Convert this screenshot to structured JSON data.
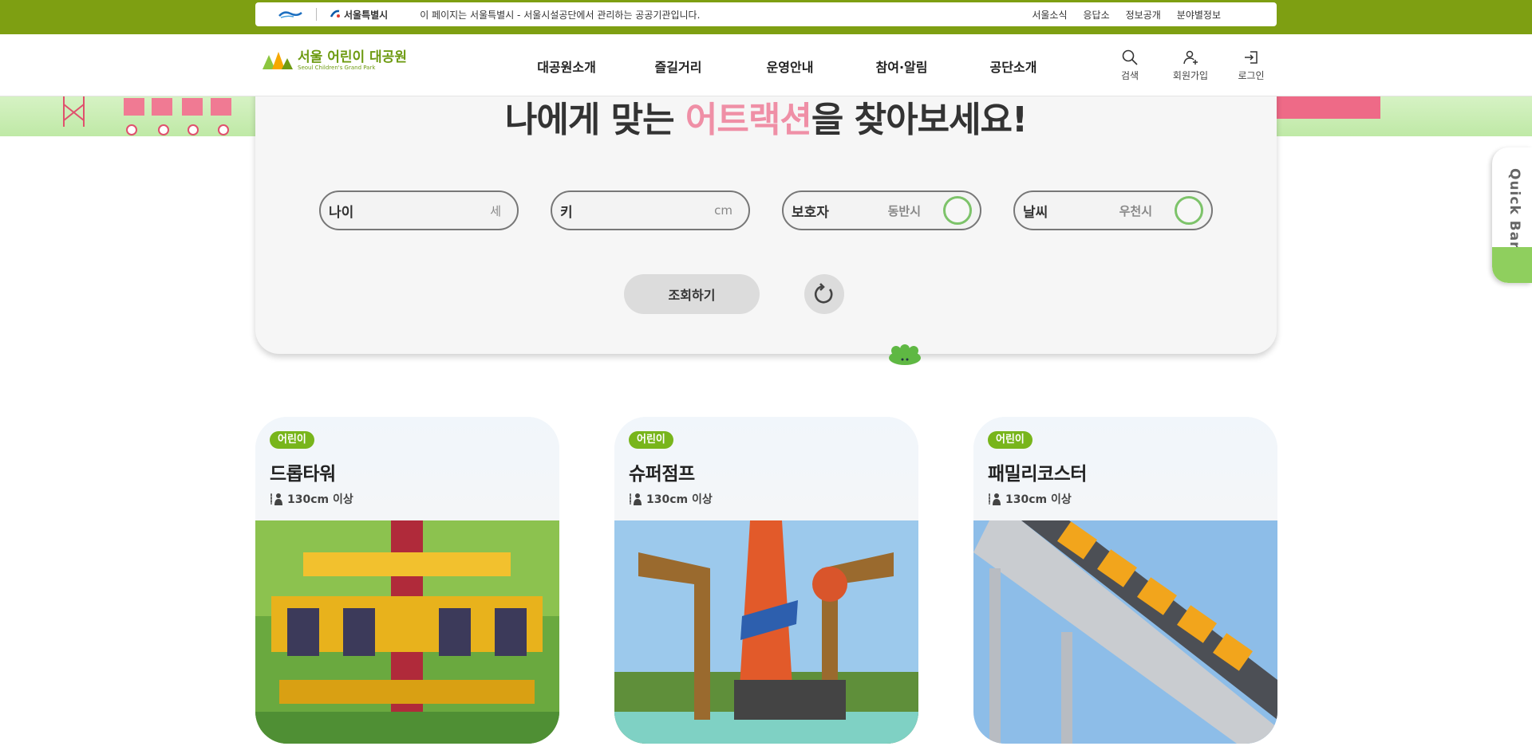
{
  "gov_bar": {
    "seoul_logo_label": "서울특별시",
    "notice": "이 페이지는 서울특별시 - 서울시설공단에서 관리하는 공공기관입니다.",
    "links": [
      "서울소식",
      "응답소",
      "정보공개",
      "분야별정보"
    ]
  },
  "header": {
    "logo_title": "서울 어린이 대공원",
    "logo_subtitle": "Seoul Children's Grand Park",
    "nav": [
      "대공원소개",
      "즐길거리",
      "운영안내",
      "참여·알림",
      "공단소개"
    ],
    "utils": [
      {
        "label": "검색",
        "icon": "search-icon"
      },
      {
        "label": "회원가입",
        "icon": "user-add-icon"
      },
      {
        "label": "로그인",
        "icon": "login-icon"
      }
    ]
  },
  "finder": {
    "title_before": "나에게 맞는 ",
    "title_highlight": "어트랙션",
    "title_after": "을 찾아보세요!",
    "fields": {
      "age": {
        "label": "나이",
        "unit": "세"
      },
      "height": {
        "label": "키",
        "unit": "cm"
      },
      "guardian": {
        "label": "보호자",
        "option": "동반시"
      },
      "weather": {
        "label": "날씨",
        "option": "우천시"
      }
    },
    "search_label": "조회하기"
  },
  "quickbar": {
    "label": "Quick Bar"
  },
  "cards": [
    {
      "badge": "어린이",
      "title": "드롭타워",
      "height": "130cm 이상"
    },
    {
      "badge": "어린이",
      "title": "슈퍼점프",
      "height": "130cm 이상"
    },
    {
      "badge": "어린이",
      "title": "패밀리코스터",
      "height": "130cm 이상"
    }
  ],
  "colors": {
    "brand_green": "#7e9f12",
    "accent_pink": "#ef8fa6",
    "toggle_green": "#7dc36a"
  }
}
